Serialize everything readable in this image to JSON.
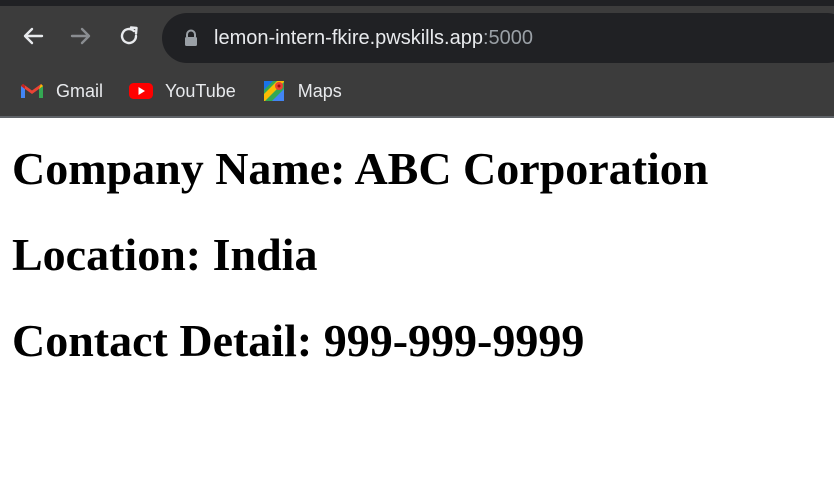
{
  "browser": {
    "url": {
      "host": "lemon-intern-fkire.pwskills.app",
      "port": ":5000"
    },
    "bookmarks": [
      {
        "label": "Gmail",
        "icon": "gmail-icon"
      },
      {
        "label": "YouTube",
        "icon": "youtube-icon"
      },
      {
        "label": "Maps",
        "icon": "maps-icon"
      }
    ]
  },
  "page": {
    "headings": [
      "Company Name: ABC Corporation",
      "Location: India",
      "Contact Detail: 999-999-9999"
    ]
  }
}
